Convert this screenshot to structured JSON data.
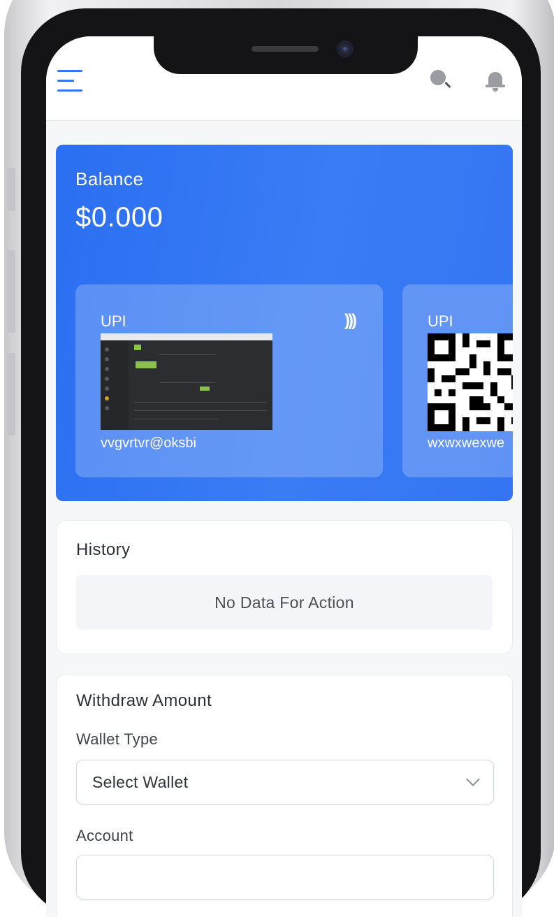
{
  "header": {
    "menu_icon": "hamburger-menu-icon",
    "search_icon": "search-icon",
    "notification_icon": "bell-icon"
  },
  "balance": {
    "label": "Balance",
    "amount": "$0.000"
  },
  "upi_cards": [
    {
      "title": "UPI",
      "id": "vvgvrtvr@oksbi",
      "icon": "contactless-icon"
    },
    {
      "title": "UPI",
      "id": "wxwxwexwe"
    }
  ],
  "history": {
    "title": "History",
    "empty_text": "No Data For Action"
  },
  "withdraw": {
    "title": "Withdraw Amount",
    "wallet_type_label": "Wallet Type",
    "wallet_select_value": "Select Wallet",
    "account_label": "Account"
  },
  "colors": {
    "accent": "#2b6ff2",
    "background": "#f6f7f9"
  }
}
